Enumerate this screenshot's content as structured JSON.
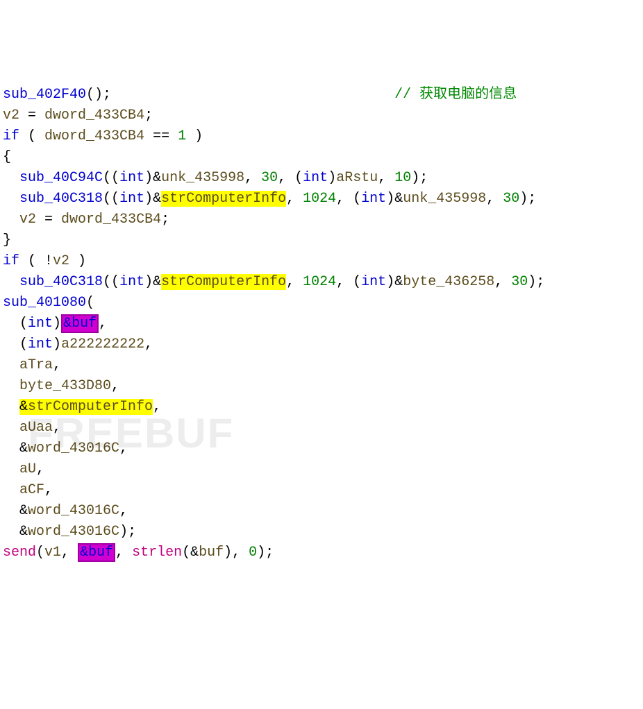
{
  "comment": "// 获取电脑的信息",
  "l1a": "sub_402F40",
  "l1b": "();",
  "l2a": "v2",
  "l2b": " = ",
  "l2c": "dword_433CB4",
  "l2d": ";",
  "l3a": "if",
  "l3b": " ( ",
  "l3c": "dword_433CB4",
  "l3d": " == ",
  "l3e": "1",
  "l3f": " )",
  "l4": "{",
  "l5a": "sub_40C94C",
  "l5b": "((",
  "l5c": "int",
  "l5d": ")&",
  "l5e": "unk_435998",
  "l5f": ", ",
  "l5g": "30",
  "l5h": ", (",
  "l5i": "int",
  "l5j": ")",
  "l5k": "aRstu",
  "l5l": ", ",
  "l5m": "10",
  "l5n": ");",
  "l6a": "sub_40C318",
  "l6b": "((",
  "l6c": "int",
  "l6d": ")&",
  "l6e": "strComputerInfo",
  "l6f": ", ",
  "l6g": "1024",
  "l6h": ", (",
  "l6i": "int",
  "l6j": ")&",
  "l6k": "unk_435998",
  "l6l": ", ",
  "l6m": "30",
  "l6n": ");",
  "l7a": "v2",
  "l7b": " = ",
  "l7c": "dword_433CB4",
  "l7d": ";",
  "l8": "}",
  "l9a": "if",
  "l9b": " ( !",
  "l9c": "v2",
  "l9d": " )",
  "l10a": "sub_40C318",
  "l10b": "((",
  "l10c": "int",
  "l10d": ")&",
  "l10e": "strComputerInfo",
  "l10f": ", ",
  "l10g": "1024",
  "l10h": ", (",
  "l10i": "int",
  "l10j": ")&",
  "l10k": "byte_436258",
  "l10l": ", ",
  "l10m": "30",
  "l10n": ");",
  "l11a": "sub_401080",
  "l11b": "(",
  "l12a": "(",
  "l12b": "int",
  "l12c": ")",
  "l12d": "&buf",
  "l12e": ",",
  "l13a": "(",
  "l13b": "int",
  "l13c": ")",
  "l13d": "a222222222",
  "l13e": ",",
  "l14a": "aTra",
  "l14b": ",",
  "l15a": "byte_433D80",
  "l15b": ",",
  "l16a": "strComputerInfo",
  "l16amp": "&",
  "l16b": ",",
  "l17a": "aUaa",
  "l17b": ",",
  "l18a": "word_43016C",
  "l18amp": "&",
  "l18b": ",",
  "l19a": "aU",
  "l19b": ",",
  "l20a": "aCF",
  "l20b": ",",
  "l21a": "word_43016C",
  "l21amp": "&",
  "l21b": ",",
  "l22a": "word_43016C",
  "l22amp": "&",
  "l22b": ");",
  "l23a": "send",
  "l23b": "(",
  "l23c": "v1",
  "l23d": ", ",
  "l23e": "&buf",
  "l23f": ", ",
  "l23g": "strlen",
  "l23h": "(&",
  "l23i": "buf",
  "l23j": "), ",
  "l23k": "0",
  "l23l": ");",
  "watermark": "FREEBUF"
}
